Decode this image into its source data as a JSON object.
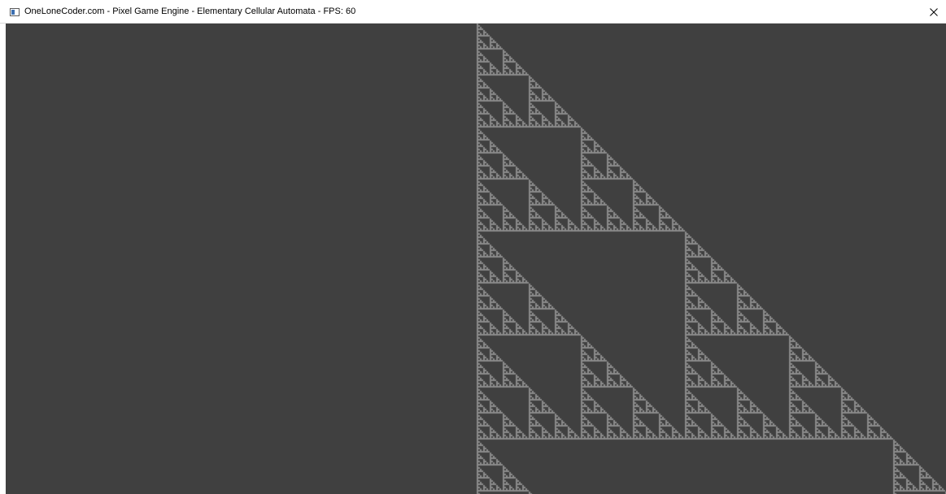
{
  "window": {
    "title": "OneLoneCoder.com - Pixel Game Engine - Elementary Cellular Automata - FPS: 60",
    "app_icon": "window-app-icon",
    "close_icon": "close-icon"
  },
  "simulation": {
    "pattern": "sierpinski-triangle",
    "background_color": "#404040",
    "cell_color": "#8a8a8a",
    "titlebar_color": "#ffffff"
  }
}
